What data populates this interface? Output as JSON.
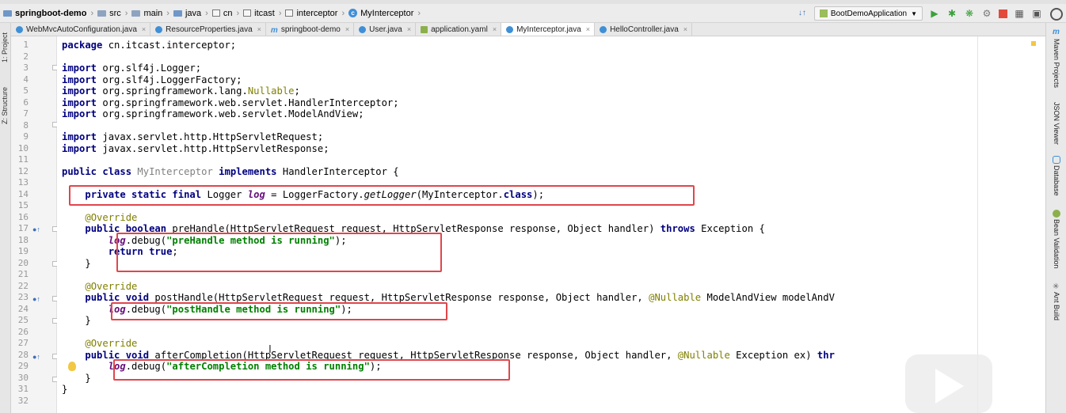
{
  "breadcrumbs": [
    {
      "label": "springboot-demo",
      "icon": "module-folder-icon",
      "bold": true
    },
    {
      "label": "src",
      "icon": "folder-icon"
    },
    {
      "label": "main",
      "icon": "folder-icon"
    },
    {
      "label": "java",
      "icon": "source-folder-icon"
    },
    {
      "label": "cn",
      "icon": "package-icon"
    },
    {
      "label": "itcast",
      "icon": "package-icon"
    },
    {
      "label": "interceptor",
      "icon": "package-icon"
    },
    {
      "label": "MyInterceptor",
      "icon": "class-icon"
    }
  ],
  "toolbar": {
    "run_config": "BootDemoApplication",
    "run_icon": "play-icon",
    "debug_icon": "bug-icon",
    "stop_icon": "stop-icon"
  },
  "tabs": [
    {
      "label": "WebMvcAutoConfiguration.java",
      "icon": "c",
      "active": false
    },
    {
      "label": "ResourceProperties.java",
      "icon": "c",
      "active": false
    },
    {
      "label": "springboot-demo",
      "icon": "m",
      "active": false
    },
    {
      "label": "User.java",
      "icon": "c",
      "active": false
    },
    {
      "label": "application.yaml",
      "icon": "y",
      "active": false
    },
    {
      "label": "MyInterceptor.java",
      "icon": "c",
      "active": true
    },
    {
      "label": "HelloController.java",
      "icon": "c",
      "active": false
    }
  ],
  "left_tools": [
    "1: Project",
    "Z: Structure"
  ],
  "right_tools": [
    "Maven Projects",
    "JSON Viewer",
    "Database",
    "Bean Validation",
    "Ant Build"
  ],
  "line_numbers": [
    "1",
    "2",
    "3",
    "4",
    "5",
    "6",
    "7",
    "8",
    "9",
    "10",
    "11",
    "12",
    "13",
    "14",
    "15",
    "16",
    "17",
    "18",
    "19",
    "20",
    "21",
    "22",
    "23",
    "24",
    "25",
    "26",
    "27",
    "28",
    "29",
    "30",
    "31",
    "32"
  ],
  "code": {
    "l1": {
      "kw": "package",
      "rest": " cn.itcast.interceptor;"
    },
    "l3": {
      "kw": "import",
      "rest": " org.slf4j.Logger;"
    },
    "l4": {
      "kw": "import",
      "rest": " org.slf4j.LoggerFactory;"
    },
    "l5": {
      "kw": "import",
      "pre": " org.springframework.lang.",
      "ann": "Nullable",
      "post": ";"
    },
    "l6": {
      "kw": "import",
      "rest": " org.springframework.web.servlet.HandlerInterceptor;"
    },
    "l7": {
      "kw": "import",
      "rest": " org.springframework.web.servlet.ModelAndView;"
    },
    "l9": {
      "kw": "import",
      "rest": " javax.servlet.http.HttpServletRequest;"
    },
    "l10": {
      "kw": "import",
      "rest": " javax.servlet.http.HttpServletResponse;"
    },
    "l12": {
      "kw1": "public class",
      "name": "MyInterceptor",
      "kw2": "implements",
      "rest": " HandlerInterceptor {"
    },
    "l14": {
      "kw": "private static final",
      "type": " Logger ",
      "field": "log",
      "eq": " = LoggerFactory.",
      "method": "getLogger",
      "args": "(MyInterceptor.",
      "kw2": "class",
      "end": ");"
    },
    "l16": {
      "ann": "@Override"
    },
    "l17": {
      "kw": "public boolean",
      "sig": " preHandle(HttpServletRequest request, HttpServletResponse response, Object handler) ",
      "kw2": "throws",
      "rest": " Exception {"
    },
    "l18": {
      "field": "log",
      "call": ".debug(",
      "str": "\"preHandle method is running\"",
      "end": ");"
    },
    "l19": {
      "kw": "return true",
      "end": ";"
    },
    "l20": {
      "text": "}"
    },
    "l22": {
      "ann": "@Override"
    },
    "l23": {
      "kw": "public void",
      "sig": " postHandle(HttpServletRequest request, HttpServletResponse response, Object handler, ",
      "ann": "@Nullable",
      "rest": " ModelAndView modelAndV"
    },
    "l24": {
      "field": "log",
      "call": ".debug(",
      "str": "\"postHandle method is running\"",
      "end": ");"
    },
    "l25": {
      "text": "}"
    },
    "l27": {
      "ann": "@Override"
    },
    "l28": {
      "kw": "public void",
      "sig": " afterCompletion(HttpServletRequest request, HttpServletResponse response, Object handler, ",
      "ann": "@Nullable",
      "rest": " Exception ex) ",
      "kw2": "thr"
    },
    "l29": {
      "field": "log",
      "call": ".debug(",
      "str": "\"afterCompletion method is running\"",
      "end": ");"
    },
    "l30": {
      "text": "}"
    },
    "l31": {
      "text": "}"
    }
  },
  "colors": {
    "keyword": "#000080",
    "annotation": "#808000",
    "string": "#008000",
    "field": "#660e7a",
    "highlight_box": "#e0464b"
  },
  "icons": {
    "gutter_override": "override-gutter-icon",
    "intention": "lightbulb-icon",
    "video": "play-overlay-icon"
  }
}
